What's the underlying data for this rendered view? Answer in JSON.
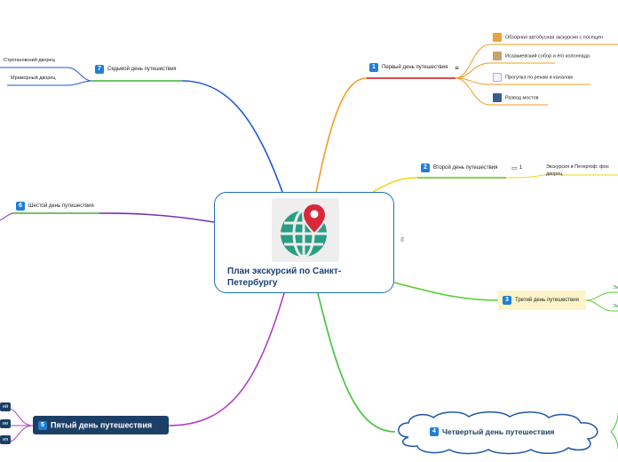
{
  "root": {
    "title": "План экскурсий по Санкт-Петербургу",
    "icon": "map-pin-globe-icon"
  },
  "colors": {
    "border": "#1f6fb4",
    "badge": "#1f7fd6",
    "orange": "#f39c1f",
    "yellow": "#f2d417",
    "green": "#5fce3a",
    "purple": "#7a2fb3",
    "magenta": "#b23fc8",
    "blue": "#1f57d6",
    "navy": "#1c3f66"
  },
  "branches": [
    {
      "num": "1",
      "label": "Первый день путешествия",
      "note_icon": "notes-icon",
      "children": [
        {
          "label": "Обзорная автобусная экскурсия с посещен",
          "icon": "photo-icon"
        },
        {
          "label": "Исаакиевский собор и его колоннада",
          "icon": "cathedral-icon"
        },
        {
          "label": "Прогулка по рекам и каналам",
          "icon": "walking-person-icon"
        },
        {
          "label": "Развод мостов",
          "icon": "bridge-icon"
        }
      ]
    },
    {
      "num": "2",
      "label": "Второй день путешествия",
      "comment_count": "1",
      "children": [
        {
          "label": "Экскурсия в Петергоф: фон\nдворец"
        }
      ]
    },
    {
      "num": "3",
      "label": "Третий день путешествия",
      "children": [
        {
          "label": "Эк"
        },
        {
          "label": "Эк"
        }
      ]
    },
    {
      "num": "4",
      "label": "Четвертый день путешествия"
    },
    {
      "num": "5",
      "label": "Пятый день путешествия",
      "children": [
        {
          "label": "ей"
        },
        {
          "label": "ии"
        },
        {
          "label": "ия"
        }
      ]
    },
    {
      "num": "6",
      "label": "Шестой день путешествия"
    },
    {
      "num": "7",
      "label": "Седьмой день путешествия",
      "children": [
        {
          "label": "Строгановский дворец"
        },
        {
          "label": "Мраморный дворец"
        }
      ]
    }
  ]
}
